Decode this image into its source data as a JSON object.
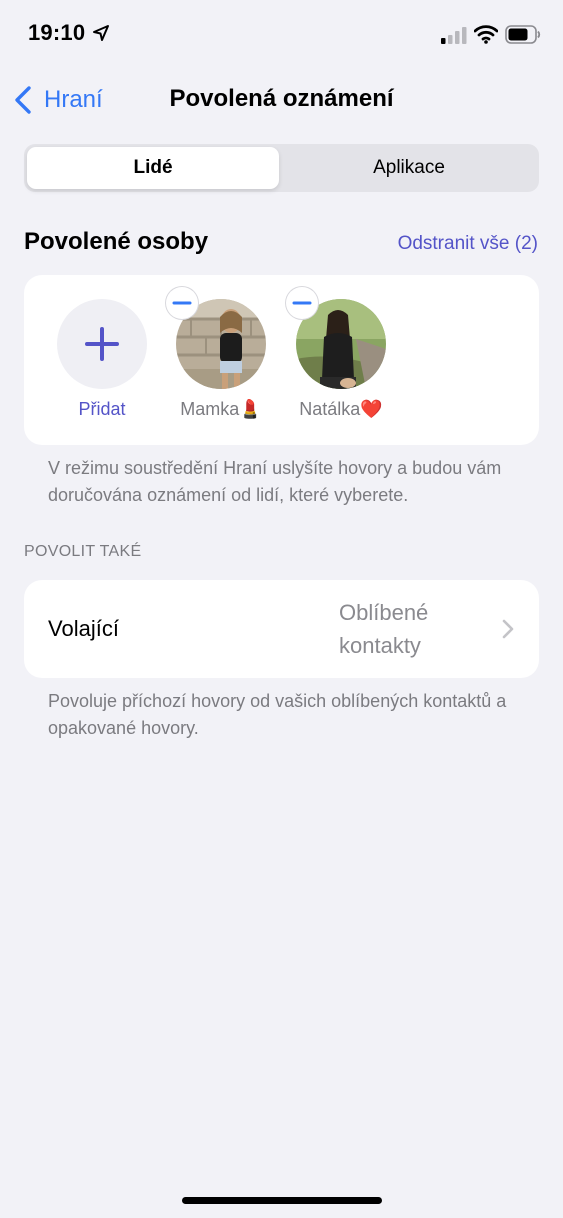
{
  "status_bar": {
    "time": "19:10",
    "icons": [
      "location-arrow-icon",
      "cellular-signal-icon",
      "wifi-icon",
      "battery-icon"
    ]
  },
  "nav": {
    "back_label": "Hraní",
    "title": "Povolená oznámení"
  },
  "segmented": {
    "selected": "Lidé",
    "tabs": [
      "Lidé",
      "Aplikace"
    ]
  },
  "people": {
    "header": "Povolené osoby",
    "remove_all": "Odstranit vše (2)",
    "add_label": "Přidat",
    "persons": [
      {
        "name": "Mamka💄"
      },
      {
        "name": "Natálka❤️"
      }
    ],
    "footnote": "V režimu soustředění Hraní uslyšíte hovory a budou vám doručována oznámení od lidí, které vyberete."
  },
  "also_allow": {
    "caption": "POVOLIT TAKÉ",
    "callers_label": "Volající",
    "callers_value": "Oblíbené kontakty",
    "footnote": "Povoluje příchozí hovory od vašich oblíbených kontaktů a opakované hovory."
  },
  "colors": {
    "accent_blue": "#3478f6",
    "accent_purple": "#5454c8",
    "background": "#f2f2f7",
    "secondary_text": "#7b7b80"
  }
}
